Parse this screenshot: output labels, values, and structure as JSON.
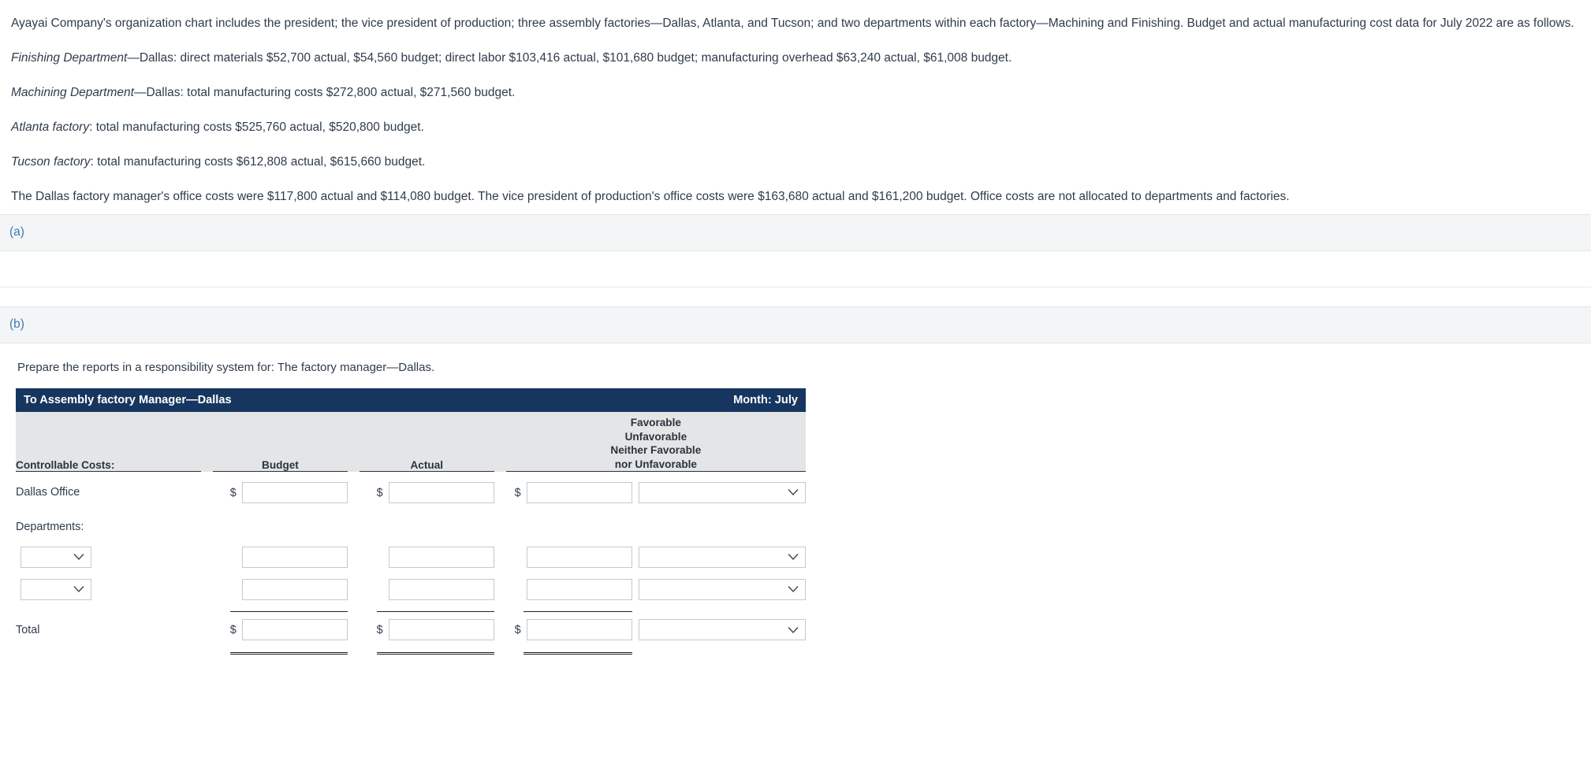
{
  "problem": {
    "paragraphs": [
      {
        "lead": "",
        "text": "Ayayai Company's organization chart includes the president; the vice president of production; three assembly factories—Dallas, Atlanta, and Tucson; and two departments within each factory—Machining and Finishing. Budget and actual manufacturing cost data for July 2022 are as follows."
      },
      {
        "lead": "Finishing Department",
        "text": "—Dallas: direct materials $52,700 actual, $54,560 budget; direct labor $103,416 actual, $101,680 budget; manufacturing overhead $63,240 actual, $61,008 budget."
      },
      {
        "lead": "Machining Department",
        "text": "—Dallas: total manufacturing costs $272,800 actual, $271,560 budget."
      },
      {
        "lead": "Atlanta factory",
        "text": ": total manufacturing costs $525,760 actual, $520,800 budget."
      },
      {
        "lead": "Tucson factory",
        "text": ": total manufacturing costs $612,808 actual, $615,660 budget."
      },
      {
        "lead": "",
        "text": "The Dallas factory manager's office costs were $117,800 actual and $114,080 budget. The vice president of production's office costs were $163,680 actual and $161,200 budget. Office costs are not allocated to departments and factories."
      }
    ]
  },
  "sections": {
    "a_label": "(a)",
    "b_label": "(b)"
  },
  "instruction": "Prepare the reports in a responsibility system for: The factory manager—Dallas.",
  "report": {
    "title_left": "To Assembly factory Manager—Dallas",
    "title_right": "Month: July",
    "columns": {
      "controllable": "Controllable Costs:",
      "budget": "Budget",
      "actual": "Actual",
      "variance_lines": [
        "Favorable",
        "Unfavorable",
        "Neither Favorable",
        "nor Unfavorable"
      ]
    },
    "currency_symbol": "$",
    "rows": {
      "dallas_office": "Dallas Office",
      "departments": "Departments:",
      "total": "Total"
    },
    "input_values": {
      "dallas_budget": "",
      "dallas_actual": "",
      "dallas_variance": "",
      "dept1_budget": "",
      "dept1_actual": "",
      "dept1_variance": "",
      "dept2_budget": "",
      "dept2_actual": "",
      "dept2_variance": "",
      "total_budget": "",
      "total_actual": "",
      "total_variance": ""
    },
    "select_placeholder": "",
    "variance_options": [
      "",
      "Favorable",
      "Unfavorable",
      "Neither Favorable nor Unfavorable"
    ],
    "department_options": [
      "",
      "Machining",
      "Finishing"
    ],
    "chevron_icon": "⌄"
  },
  "colors": {
    "header_navy": "#16365f",
    "band_gray": "#f4f5f6",
    "subhead_gray": "#e4e5e7",
    "link_blue": "#3d7ab5",
    "text": "#2f3c4c"
  }
}
